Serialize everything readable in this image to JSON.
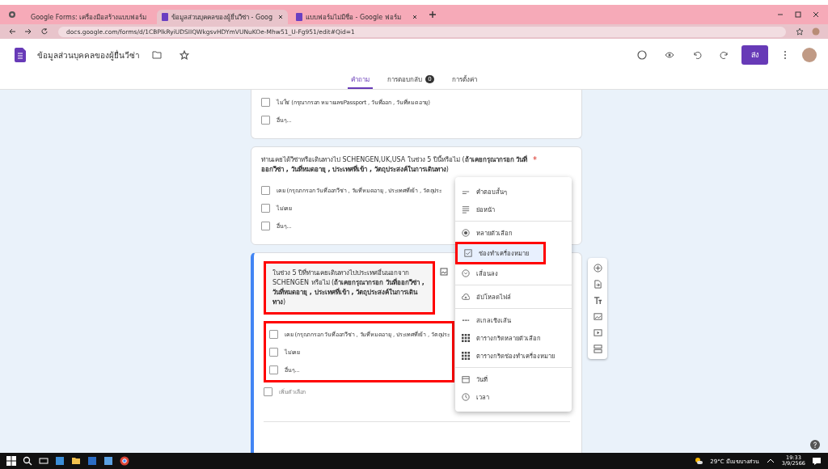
{
  "browser": {
    "tabs": [
      {
        "label": "Google Forms: เครื่องมือสร้างแบบฟอร์ม",
        "selected": false
      },
      {
        "label": "ข้อมูลส่วนบุคคลของผู้ยื่นวีซ่า - Goog",
        "selected": true
      },
      {
        "label": "แบบฟอร์มไม่มีชื่อ - Google ฟอร์ม",
        "selected": false
      }
    ],
    "url": "docs.google.com/forms/d/1CBPlkRyiUDSIIQWkgsvHDYmVUNuKOe-Mhw51_U-Fg951/edit#Qid=1"
  },
  "form": {
    "title": "ข้อมูลส่วนบุคคลของผู้ยื่นวีซ่า",
    "send_label": "ส่ง",
    "tabs": [
      {
        "label": "คำถาม",
        "selected": true
      },
      {
        "label": "การตอบกลับ",
        "selected": false,
        "badge": "0"
      },
      {
        "label": "การตั้งค่า",
        "selected": false
      }
    ]
  },
  "cards": [
    {
      "active": false,
      "options": [
        "ไม่ใช่ (กรุณากรอก หมายเลขPassport , วันที่ออก , วันที่หมดอายุ)",
        "อื่นๆ..."
      ]
    },
    {
      "active": false,
      "title": "ท่านเคยได้วีซ่าหรือเดินทางไป SCHENGEN,UK,USA ในช่วง 5 ปีนี้หรือไม่ (**ถ้าเคยกรุณากรอก วันที่ออกวีซ่า , วันที่หมดอายุ , ประเทศที่เข้า , วัตถุประสงค์ในการเดินทาง**)",
      "required_mark": "*",
      "options": [
        "เคย (กรุณากรอก วันที่ออกวีซ่า , วันที่หมดอายุ , ประเทศที่เข้า , วัตถุประ",
        "ไม่เคย",
        "อื่นๆ..."
      ]
    },
    {
      "active": true,
      "title": "ในช่วง 5 ปีที่ท่านเคยเดินทางไปประเทศอื่นนอกจาก SCHENGEN หรือไม่ (**ถ้าเคยกรุณากรอก วันที่ออกวีซ่า , วันที่หมดอายุ , ประเทศที่เข้า , วัตถุประสงค์ในการเดินทาง**)",
      "title_annotated": true,
      "options_annotated": true,
      "options": [
        "เคย (กรุณากรอก วันที่ออกวีซ่า , วันที่หมดอายุ , ประเทศที่เข้า , วัตถุประ",
        "ไม่เคย",
        "อื่นๆ..."
      ],
      "add_option": "เพิ่มตัวเลือก"
    }
  ],
  "menu": [
    [
      {
        "kind": "short",
        "label": "คำตอบสั้นๆ",
        "selected": false,
        "annotated": false
      },
      {
        "kind": "paragraph",
        "label": "ย่อหน้า",
        "selected": false,
        "annotated": false
      }
    ],
    [
      {
        "kind": "radio",
        "label": "หลายตัวเลือก",
        "selected": false,
        "annotated": false
      },
      {
        "kind": "checkbox",
        "label": "ช่องทำเครื่องหมาย",
        "selected": true,
        "annotated": true
      },
      {
        "kind": "dropdown",
        "label": "เลื่อนลง",
        "selected": false,
        "annotated": false
      }
    ],
    [
      {
        "kind": "upload",
        "label": "อัปโหลดไฟล์",
        "selected": false,
        "annotated": false
      }
    ],
    [
      {
        "kind": "scale",
        "label": "สเกลเชิงเส้น",
        "selected": false,
        "annotated": false
      },
      {
        "kind": "grid",
        "label": "ตารางกริดหลายตัวเลือก",
        "selected": false,
        "annotated": false
      },
      {
        "kind": "grid",
        "label": "ตารางกริดช่องทำเครื่องหมาย",
        "selected": false,
        "annotated": false
      }
    ],
    [
      {
        "kind": "date",
        "label": "วันที่",
        "selected": false,
        "annotated": false
      },
      {
        "kind": "time",
        "label": "เวลา",
        "selected": false,
        "annotated": false
      }
    ]
  ],
  "taskbar": {
    "weather": "29°C มีเมฆบางส่วน",
    "time": "19:33",
    "date": "3/9/2566"
  }
}
